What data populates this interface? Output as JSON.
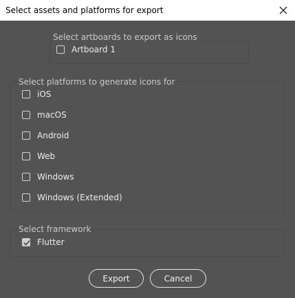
{
  "window": {
    "title": "Select assets and platforms for export"
  },
  "artboards": {
    "legend": "Select artboards to export as icons",
    "items": [
      {
        "label": "Artboard 1",
        "checked": false
      }
    ]
  },
  "platforms": {
    "legend": "Select platforms to generate icons for",
    "items": [
      {
        "label": "iOS",
        "checked": false
      },
      {
        "label": "macOS",
        "checked": false
      },
      {
        "label": "Android",
        "checked": false
      },
      {
        "label": "Web",
        "checked": false
      },
      {
        "label": "Windows",
        "checked": false
      },
      {
        "label": "Windows (Extended)",
        "checked": false
      }
    ]
  },
  "framework": {
    "legend": "Select framework",
    "items": [
      {
        "label": "Flutter",
        "checked": true
      }
    ]
  },
  "buttons": {
    "export_label": "Export",
    "cancel_label": "Cancel"
  },
  "colors": {
    "background": "#535353",
    "titlebar": "#ffffff",
    "text": "#ececec"
  }
}
